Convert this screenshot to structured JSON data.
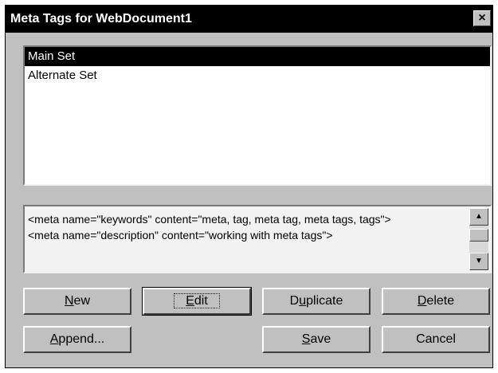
{
  "window": {
    "title": "Meta Tags for WebDocument1",
    "close_glyph": "×"
  },
  "sets": [
    {
      "label": "Main Set",
      "selected": true
    },
    {
      "label": "Alternate Set",
      "selected": false
    }
  ],
  "preview": {
    "lines": [
      "<meta name=\"keywords\" content=\"meta, tag, meta tag, meta tags, tags\">",
      "<meta name=\"description\" content=\"working with meta tags\">"
    ]
  },
  "buttons": {
    "new": {
      "pre": "",
      "mn": "N",
      "post": "ew"
    },
    "edit": {
      "pre": "",
      "mn": "E",
      "post": "dit"
    },
    "duplicate": {
      "pre": "D",
      "mn": "u",
      "post": "plicate"
    },
    "delete": {
      "pre": "",
      "mn": "D",
      "post": "elete"
    },
    "append": {
      "pre": "",
      "mn": "A",
      "post": "ppend..."
    },
    "save": {
      "pre": "",
      "mn": "S",
      "post": "ave"
    },
    "cancel": {
      "label": "Cancel"
    }
  }
}
